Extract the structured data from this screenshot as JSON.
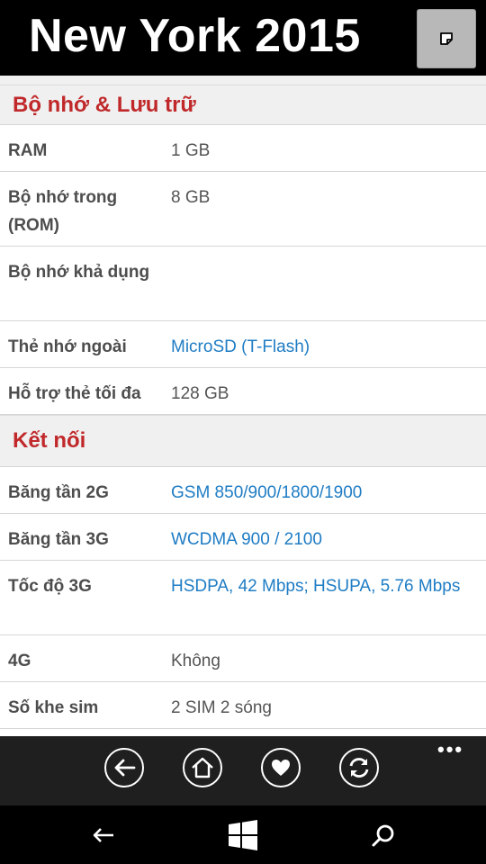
{
  "header": {
    "title": "New York 2015",
    "note_icon": "note-icon"
  },
  "sections": [
    {
      "title": "Bộ nhớ & Lưu trữ",
      "rows": [
        {
          "label": "RAM",
          "value": "1 GB",
          "link": false
        },
        {
          "label": "Bộ nhớ trong (ROM)",
          "value": "8 GB",
          "link": false
        },
        {
          "label": "Bộ nhớ khả dụng",
          "value": "",
          "link": false
        },
        {
          "label": "Thẻ nhớ ngoài",
          "value": "MicroSD (T-Flash)",
          "link": true
        },
        {
          "label": "Hỗ trợ thẻ tối đa",
          "value": "128 GB",
          "link": false
        }
      ]
    },
    {
      "title": "Kết nối",
      "rows": [
        {
          "label": "Băng tần 2G",
          "value": "GSM 850/900/1800/1900",
          "link": true
        },
        {
          "label": "Băng tần 3G",
          "value": "WCDMA 900 / 2100",
          "link": true
        },
        {
          "label": "Tốc độ 3G",
          "value": "HSDPA, 42 Mbps; HSUPA, 5.76 Mbps",
          "link": true
        },
        {
          "label": "4G",
          "value": "Không",
          "link": false
        },
        {
          "label": "Số khe sim",
          "value": "2 SIM 2 sóng",
          "link": false
        }
      ]
    }
  ],
  "app_bar": {
    "buttons": [
      "back-icon",
      "home-icon",
      "heart-icon",
      "refresh-icon"
    ],
    "more": "•••"
  },
  "nav_bar": {
    "buttons": [
      "back-arrow-icon",
      "windows-icon",
      "search-icon"
    ]
  },
  "colors": {
    "section_title": "#c0282a",
    "link": "#1e7cc4",
    "label": "#4d4d4d",
    "header_bg": "#000000"
  }
}
